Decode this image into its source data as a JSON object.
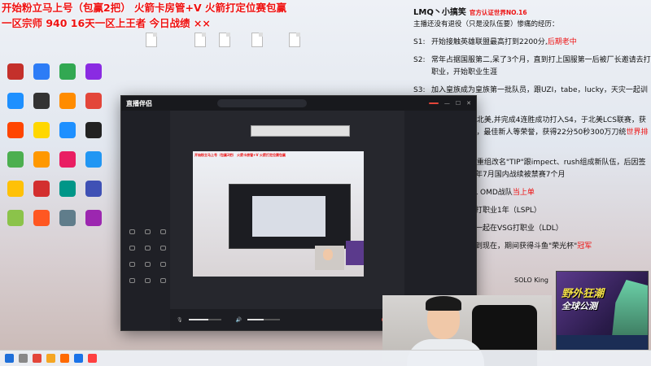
{
  "overlay": {
    "line1": "开始粉立马上号（包赢2把） 火箭卡房管+V 火箭打定位赛包赢",
    "line2": "一区宗师 940  16天一区上王者 今日战绩 ××"
  },
  "desktop_files": [
    "",
    "",
    "",
    "",
    ""
  ],
  "desktop_icons": [
    {
      "label": "",
      "color": "#c4302b"
    },
    {
      "label": "",
      "color": "#2d7cf6"
    },
    {
      "label": "",
      "color": "#32a852"
    },
    {
      "label": "",
      "color": "#8a2be2"
    },
    {
      "label": "",
      "color": "#1e90ff"
    },
    {
      "label": "",
      "color": "#333333"
    },
    {
      "label": "",
      "color": "#ff8c00"
    },
    {
      "label": "",
      "color": "#e3463a"
    },
    {
      "label": "",
      "color": "#ff4500"
    },
    {
      "label": "",
      "color": "#ffd700"
    },
    {
      "label": "",
      "color": "#1e90ff"
    },
    {
      "label": "",
      "color": "#222222"
    },
    {
      "label": "",
      "color": "#4caf50"
    },
    {
      "label": "",
      "color": "#ff9800"
    },
    {
      "label": "",
      "color": "#e91e63"
    },
    {
      "label": "",
      "color": "#2196f3"
    },
    {
      "label": "",
      "color": "#ffc107"
    },
    {
      "label": "",
      "color": "#d32f2f"
    },
    {
      "label": "",
      "color": "#009688"
    },
    {
      "label": "",
      "color": "#3f51b5"
    },
    {
      "label": "",
      "color": "#8bc34a"
    },
    {
      "label": "",
      "color": "#ff5722"
    },
    {
      "label": "",
      "color": "#607d8b"
    },
    {
      "label": "",
      "color": "#9c27b0"
    }
  ],
  "info_panel": {
    "title": "LMQ丶小搞笑",
    "title_tag": "官方认证世界NO.16",
    "subtitle": "主播还没有退役（只是没队伍要）惨痛的经历：",
    "items": [
      {
        "k": "S1:",
        "v": "开始接触英雄联盟最高打到2200分,",
        "red": "后期老中"
      },
      {
        "k": "S2:",
        "v": "常年占据国服第二,呆了3个月，直到打上国服第一后被厂长邀请去打职业，开始职业生涯",
        "red": ""
      },
      {
        "k": "S3:",
        "v": "加入皇族成为皇族第一批队员，跟UZI，tabe，lucky，天灾一起训练",
        "red": "3个月"
      },
      {
        "k": "",
        "v": "LMQ一起征战北美,并完成4连胜成功打入S4，于北美LCS联赛，获取常规赛MVP，最佳新人等荣誉，获得22分50秒300万刀统",
        "red": "世界排名第16"
      },
      {
        "k": "",
        "v": "LMQ解散后，重组改名\"TIP\"跟impect、rush组成新队伍，后因签证问题，于同年7月国内战续被禁赛7个月",
        "red": ""
      },
      {
        "k": "",
        "v": "加入中国LSPL OMD战队",
        "red": "当上单"
      },
      {
        "k": "",
        "v": "金灿毅等一起打职业1年（LSPL）",
        "red": ""
      },
      {
        "k": "",
        "v": "黄国豪、临界一起在VSG打职业（LDL）",
        "red": ""
      },
      {
        "k": "",
        "v": "斗鱼直播一直到现在，期间获得斗鱼\"荣光杯\"",
        "red": "冠军"
      }
    ]
  },
  "app": {
    "logo": "直播伴侣",
    "search_placeholder": "",
    "record_label": "",
    "sidebar_items": [
      "",
      "",
      "",
      "",
      "",
      ""
    ],
    "sidebar_section": "",
    "tools": [
      "",
      "",
      "",
      "",
      "",
      "",
      "",
      "",
      "",
      "",
      "",
      ""
    ],
    "right_head": "",
    "right_tab": "",
    "right_empty": "",
    "bottom_mic": "",
    "bottom_spk": "",
    "mic_level": 0.6,
    "spk_level": 0.5,
    "golive_label": "",
    "bubble": ""
  },
  "solo": "SOLO King",
  "ad": {
    "line1": "野外狂潮",
    "line2": "全球公测",
    "bar": ""
  },
  "taskbar": {
    "time": "",
    "date": ""
  }
}
